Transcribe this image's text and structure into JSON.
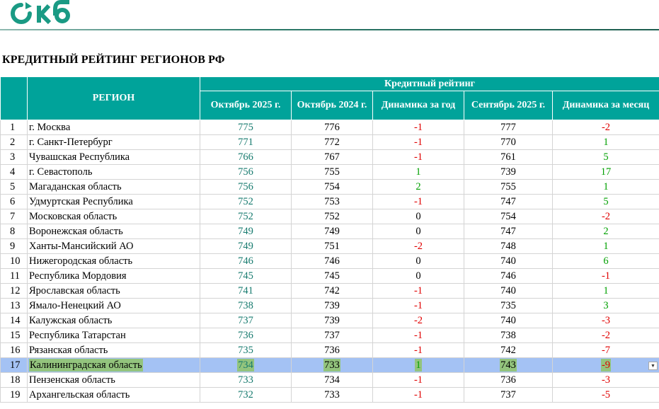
{
  "logo": {
    "text": "окб",
    "color": "#1a9a84"
  },
  "title": "КРЕДИТНЫЙ РЕЙТИНГ РЕГИОНОВ РФ",
  "header": {
    "region": "РЕГИОН",
    "group": "Кредитный рейтинг",
    "columns": [
      "Октябрь 2025 г.",
      "Октябрь 2024 г.",
      "Динамика за год",
      "Сентябрь 2025 г.",
      "Динамика за месяц"
    ]
  },
  "colors": {
    "header_bg": "#00a39a",
    "highlight_row": "#a4c2f4",
    "highlight_cell": "#93c47d",
    "negative": "#e00000",
    "positive": "#00a000"
  },
  "rows": [
    {
      "n": "1",
      "region": "г. Москва",
      "oct25": "775",
      "oct24": "776",
      "dy": "-1",
      "sep25": "777",
      "dm": "-2"
    },
    {
      "n": "2",
      "region": "г. Санкт-Петербург",
      "oct25": "771",
      "oct24": "772",
      "dy": "-1",
      "sep25": "770",
      "dm": "1"
    },
    {
      "n": "3",
      "region": "Чувашская Республика",
      "oct25": "766",
      "oct24": "767",
      "dy": "-1",
      "sep25": "761",
      "dm": "5"
    },
    {
      "n": "4",
      "region": "г. Севастополь",
      "oct25": "756",
      "oct24": "755",
      "dy": "1",
      "sep25": "739",
      "dm": "17"
    },
    {
      "n": "5",
      "region": "Магаданская область",
      "oct25": "756",
      "oct24": "754",
      "dy": "2",
      "sep25": "755",
      "dm": "1"
    },
    {
      "n": "6",
      "region": "Удмуртская Республика",
      "oct25": "752",
      "oct24": "753",
      "dy": "-1",
      "sep25": "747",
      "dm": "5"
    },
    {
      "n": "7",
      "region": "Московская область",
      "oct25": "752",
      "oct24": "752",
      "dy": "0",
      "sep25": "754",
      "dm": "-2"
    },
    {
      "n": "8",
      "region": "Воронежская область",
      "oct25": "749",
      "oct24": "749",
      "dy": "0",
      "sep25": "747",
      "dm": "2"
    },
    {
      "n": "9",
      "region": "Ханты-Мансийский АО",
      "oct25": "749",
      "oct24": "751",
      "dy": "-2",
      "sep25": "748",
      "dm": "1"
    },
    {
      "n": "10",
      "region": "Нижегородская область",
      "oct25": "746",
      "oct24": "746",
      "dy": "0",
      "sep25": "740",
      "dm": "6"
    },
    {
      "n": "11",
      "region": "Республика Мордовия",
      "oct25": "745",
      "oct24": "745",
      "dy": "0",
      "sep25": "746",
      "dm": "-1"
    },
    {
      "n": "12",
      "region": "Ярославская область",
      "oct25": "741",
      "oct24": "742",
      "dy": "-1",
      "sep25": "740",
      "dm": "1"
    },
    {
      "n": "13",
      "region": "Ямало-Ненецкий АО",
      "oct25": "738",
      "oct24": "739",
      "dy": "-1",
      "sep25": "735",
      "dm": "3"
    },
    {
      "n": "14",
      "region": "Калужская область",
      "oct25": "737",
      "oct24": "739",
      "dy": "-2",
      "sep25": "740",
      "dm": "-3"
    },
    {
      "n": "15",
      "region": "Республика Татарстан",
      "oct25": "736",
      "oct24": "737",
      "dy": "-1",
      "sep25": "738",
      "dm": "-2"
    },
    {
      "n": "16",
      "region": "Рязанская область",
      "oct25": "735",
      "oct24": "736",
      "dy": "-1",
      "sep25": "742",
      "dm": "-7"
    },
    {
      "n": "17",
      "region": "Калининградская область",
      "oct25": "734",
      "oct24": "733",
      "dy": "1",
      "sep25": "743",
      "dm": "-9",
      "highlight": true
    },
    {
      "n": "18",
      "region": "Пензенская область",
      "oct25": "733",
      "oct24": "734",
      "dy": "-1",
      "sep25": "736",
      "dm": "-3"
    },
    {
      "n": "19",
      "region": "Архангельская область",
      "oct25": "732",
      "oct24": "733",
      "dy": "-1",
      "sep25": "737",
      "dm": "-5"
    }
  ]
}
